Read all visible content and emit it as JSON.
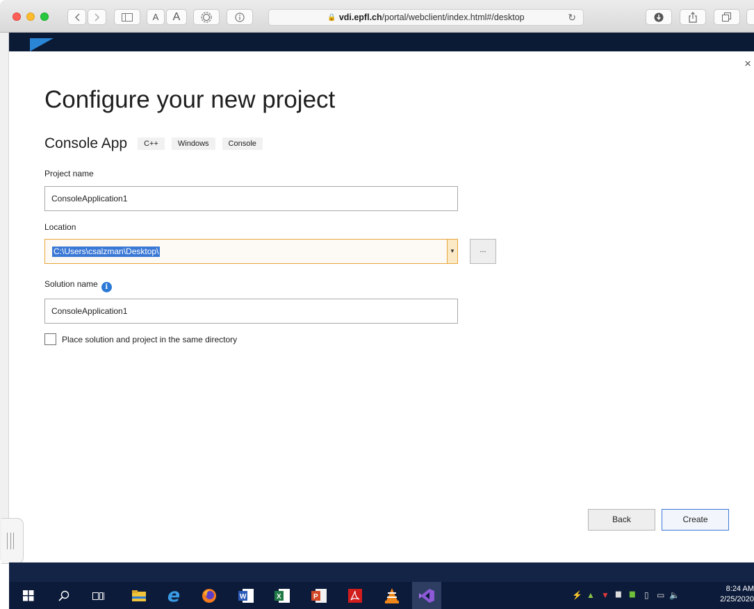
{
  "browser": {
    "url_host": "vdi.epfl.ch",
    "url_path": "/portal/webclient/index.html#/desktop",
    "text_small_label": "A",
    "text_large_label": "A"
  },
  "dialog": {
    "title": "Configure your new project",
    "template_name": "Console App",
    "tags": [
      "C++",
      "Windows",
      "Console"
    ],
    "project_name_label": "Project name",
    "project_name_value": "ConsoleApplication1",
    "location_label": "Location",
    "location_value": "C:\\Users\\csalzman\\Desktop\\",
    "browse_label": "...",
    "solution_name_label": "Solution name",
    "solution_name_value": "ConsoleApplication1",
    "same_dir_label": "Place solution and project in the same directory",
    "same_dir_checked": false,
    "back_label": "Back",
    "create_label": "Create",
    "close_glyph": "×"
  },
  "taskbar": {
    "time": "8:24 AM",
    "date": "2/25/2020",
    "apps": [
      "windows-start",
      "search",
      "task-view",
      "file-explorer",
      "internet-explorer",
      "firefox",
      "word",
      "excel",
      "powerpoint",
      "acrobat",
      "vlc",
      "visual-studio"
    ]
  },
  "colors": {
    "accent_blue": "#3a78d6",
    "focus_orange": "#e6a43a",
    "taskbar": "#0c1b3a"
  }
}
